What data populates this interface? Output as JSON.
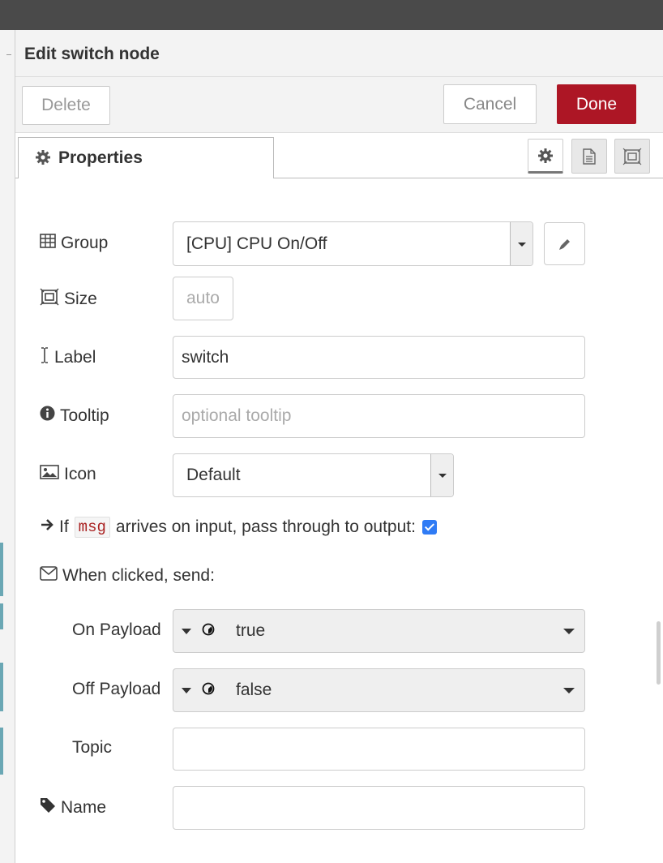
{
  "dialog": {
    "title": "Edit switch node",
    "buttons": {
      "delete": "Delete",
      "cancel": "Cancel",
      "done": "Done"
    },
    "tabs": {
      "properties": "Properties"
    }
  },
  "form": {
    "group": {
      "label": "Group",
      "value": "[CPU] CPU On/Off"
    },
    "size": {
      "label": "Size",
      "placeholder": "auto"
    },
    "label": {
      "label": "Label",
      "value": "switch"
    },
    "tooltip": {
      "label": "Tooltip",
      "placeholder": "optional tooltip"
    },
    "icon": {
      "label": "Icon",
      "value": "Default"
    },
    "passthrough": {
      "prefix": "If",
      "code": "msg",
      "suffix": "arrives on input, pass through to output:",
      "checked": true
    },
    "when_clicked": {
      "label": "When clicked, send:"
    },
    "on_payload": {
      "label": "On Payload",
      "value": "true"
    },
    "off_payload": {
      "label": "Off Payload",
      "value": "false"
    },
    "topic": {
      "label": "Topic",
      "value": ""
    },
    "name": {
      "label": "Name",
      "value": ""
    }
  },
  "colors": {
    "done_button": "#ad1625",
    "checkbox": "#2f7bf5",
    "topbar": "#4a4a4a"
  },
  "icons": [
    "gear-icon",
    "description-icon",
    "appearance-icon",
    "table-icon",
    "resize-icon",
    "text-cursor-icon",
    "info-icon",
    "image-icon",
    "arrow-right-icon",
    "envelope-icon",
    "tag-icon",
    "pencil-icon",
    "boolean-type-icon"
  ]
}
